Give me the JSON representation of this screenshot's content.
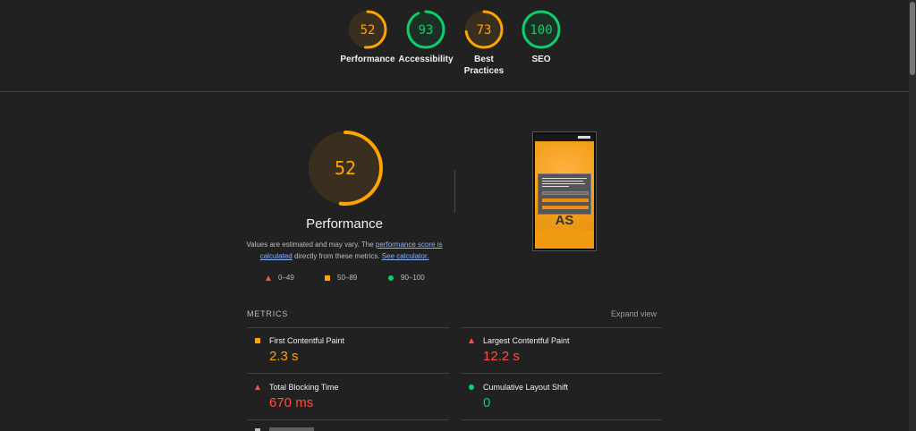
{
  "summary": {
    "gauges": [
      {
        "score": "52",
        "label": "Performance",
        "color": "#ffa400",
        "fraction": 0.52
      },
      {
        "score": "93",
        "label": "Accessibility",
        "color": "#0cce6b",
        "fraction": 0.93
      },
      {
        "score": "73",
        "label_line1": "Best",
        "label_line2": "Practices",
        "color": "#ffa400",
        "fraction": 0.73
      },
      {
        "score": "100",
        "label": "SEO",
        "color": "#0cce6b",
        "fraction": 1.0
      }
    ]
  },
  "performance": {
    "score": "52",
    "fraction": 0.52,
    "title": "Performance",
    "desc_prefix": "Values are estimated and may vary. The ",
    "desc_link1": "performance score is calculated",
    "desc_middle": " directly from these metrics. ",
    "desc_link2": "See calculator."
  },
  "legend": {
    "fail": "0–49",
    "average": "50–89",
    "pass": "90–100"
  },
  "thumbnail": {
    "big_text": "AS"
  },
  "metrics": {
    "title": "METRICS",
    "expand": "Expand view",
    "items": [
      {
        "name": "First Contentful Paint",
        "value": "2.3 s",
        "rating": "average"
      },
      {
        "name": "Largest Contentful Paint",
        "value": "12.2 s",
        "rating": "fail"
      },
      {
        "name": "Total Blocking Time",
        "value": "670 ms",
        "rating": "fail"
      },
      {
        "name": "Cumulative Layout Shift",
        "value": "0",
        "rating": "pass"
      }
    ]
  },
  "colors": {
    "fail": "#ff4e42",
    "average": "#ffa400",
    "pass": "#0cce6b",
    "background": "#212121"
  }
}
